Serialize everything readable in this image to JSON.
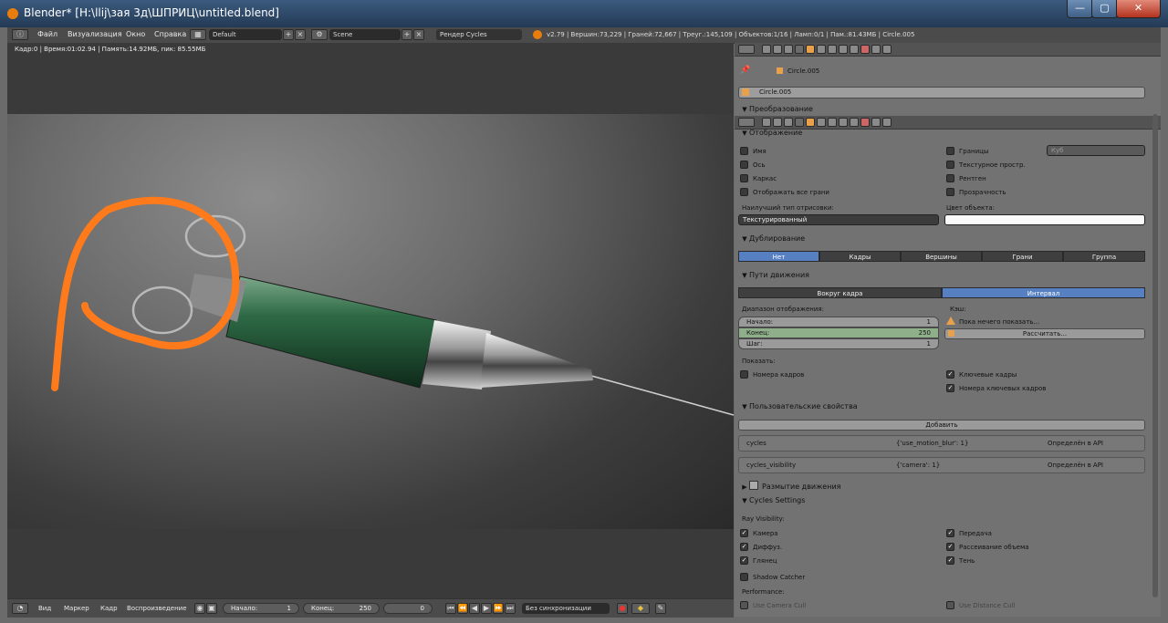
{
  "window": {
    "title": "Blender* [H:\\llij\\зая 3д\\ШПРИЦ\\untitled.blend]"
  },
  "topbar": {
    "menus": [
      "Файл",
      "Визуализация",
      "Окно",
      "Справка"
    ],
    "layout": "Default",
    "scene": "Scene",
    "engine": "Рендер Cycles",
    "stats": "v2.79 | Вершин:73,229 | Граней:72,667 | Треуг.:145,109 | Объектов:1/16 | Ламп:0/1 | Пам.:81.43МБ | Circle.005"
  },
  "viewport": {
    "info": "Кадр:0 | Время:01:02.94 | Память:14.92МБ, пик: 85.55МБ"
  },
  "timeline": {
    "menus": [
      "Вид",
      "Маркер",
      "Кадр",
      "Воспроизведение"
    ],
    "start_label": "Начало:",
    "start": "1",
    "end_label": "Конец:",
    "end": "250",
    "current": "0",
    "sync": "Без синхронизации"
  },
  "props": {
    "breadcrumb": "Circle.005",
    "object_name": "Circle.005",
    "transform_header": "Преобразование",
    "display": {
      "header": "Отображение",
      "left": [
        "Имя",
        "Ось",
        "Каркас",
        "Отображать все грани"
      ],
      "right": [
        "Границы",
        "Текстурное простр.",
        "Рентген",
        "Прозрачность"
      ],
      "bounds_type": "Куб",
      "max_draw_label": "Наилучший тип отрисовки:",
      "max_draw_value": "Текстурированный",
      "obj_color_label": "Цвет объекта:"
    },
    "duplication": {
      "header": "Дублирование",
      "options": [
        "Нет",
        "Кадры",
        "Вершины",
        "Грани",
        "Группа"
      ]
    },
    "motion_paths": {
      "header": "Пути движения",
      "modes": [
        "Вокруг кадра",
        "Интервал"
      ],
      "range_label": "Диапазон отображения:",
      "start_label": "Начало:",
      "start": "1",
      "end_label": "Конец:",
      "end": "250",
      "step_label": "Шаг:",
      "step": "1",
      "cache_label": "Кэш:",
      "cache_note": "Пока нечего показать...",
      "calc_button": "Рассчитать...",
      "show_label": "Показать:",
      "frame_numbers": "Номера кадров",
      "keyframes": "Ключевые кадры",
      "keyframe_numbers": "Номера ключевых кадров"
    },
    "custom": {
      "header": "Пользовательские свойства",
      "add_button": "Добавить",
      "rows": [
        {
          "name": "cycles",
          "value": "{'use_motion_blur': 1}",
          "api": "Определён в API"
        },
        {
          "name": "cycles_visibility",
          "value": "{'camera': 1}",
          "api": "Определён в API"
        }
      ]
    },
    "motion_blur": {
      "header": "Размытие движения"
    },
    "cycles": {
      "header": "Cycles Settings",
      "ray_label": "Ray Visibility:",
      "left": [
        "Камера",
        "Диффуз.",
        "Глянец"
      ],
      "right": [
        "Передача",
        "Рассеивание объема",
        "Тень"
      ],
      "shadow_catcher": "Shadow Catcher",
      "perf_label": "Performance:",
      "camera_cull": "Use Camera Cull",
      "distance_cull": "Use Distance Cull"
    }
  },
  "colors": {
    "accent": "#5680c2",
    "annotation": "#ff7a1a",
    "glass": "#2e6a45"
  }
}
